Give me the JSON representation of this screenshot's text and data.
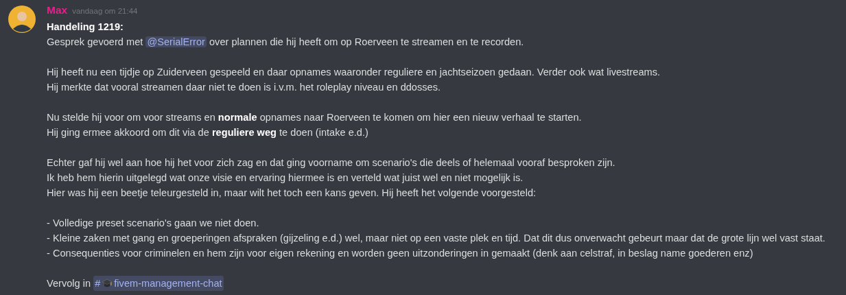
{
  "message": {
    "author": "Max",
    "timestamp": "vandaag om 21:44",
    "heading": "Handeling 1219:",
    "paragraphs": [
      {
        "lines": [
          [
            {
              "kind": "text",
              "text": "Gesprek gevoerd met "
            },
            {
              "kind": "mention",
              "text": "@SerialError"
            },
            {
              "kind": "text",
              "text": " over plannen die hij heeft om op Roerveen te streamen en te recorden."
            }
          ]
        ]
      },
      {
        "lines": [
          [
            {
              "kind": "text",
              "text": "Hij heeft nu een tijdje op Zuiderveen gespeeld en daar opnames waaronder reguliere en jachtseizoen gedaan. Verder ook wat livestreams."
            }
          ],
          [
            {
              "kind": "text",
              "text": "Hij merkte dat vooral streamen daar niet te doen is i.v.m. het roleplay niveau en ddosses."
            }
          ]
        ]
      },
      {
        "lines": [
          [
            {
              "kind": "text",
              "text": "Nu stelde hij voor om voor streams en **normale** opnames naar Roerveen te komen om hier een nieuw verhaal te starten."
            }
          ],
          [
            {
              "kind": "text",
              "text": "Hij ging ermee akkoord om dit via de **reguliere weg** te doen (intake e.d.)"
            }
          ]
        ]
      },
      {
        "lines": [
          [
            {
              "kind": "text",
              "text": "Echter gaf hij wel aan hoe hij het voor zich zag en dat ging voorname om scenario's die deels of helemaal vooraf besproken zijn."
            }
          ],
          [
            {
              "kind": "text",
              "text": "Ik heb hem hierin uitgelegd wat onze visie en ervaring hiermee is en verteld wat juist wel en niet mogelijk is."
            }
          ],
          [
            {
              "kind": "text",
              "text": "Hier was hij een beetje teleurgesteld in, maar wilt het toch een kans geven. Hij heeft het volgende voorgesteld:"
            }
          ]
        ]
      },
      {
        "lines": [
          [
            {
              "kind": "text",
              "text": "- Volledige preset scenario's gaan we niet doen."
            }
          ],
          [
            {
              "kind": "text",
              "text": "- Kleine zaken met gang en groeperingen afspraken (gijzeling e.d.) wel, maar niet op een vaste plek en tijd. Dat dit dus onverwacht gebeurt maar dat de grote lijn wel vast staat."
            }
          ],
          [
            {
              "kind": "text",
              "text": "- Consequenties voor criminelen en hem zijn voor eigen rekening en worden geen uitzonderingen in gemaakt (denk aan celstraf, in beslag name goederen enz)"
            }
          ]
        ]
      },
      {
        "lines": [
          [
            {
              "kind": "text",
              "text": "Vervolg in "
            },
            {
              "kind": "channel",
              "hash": "#",
              "text": "fivem-management-chat"
            }
          ]
        ]
      }
    ]
  }
}
